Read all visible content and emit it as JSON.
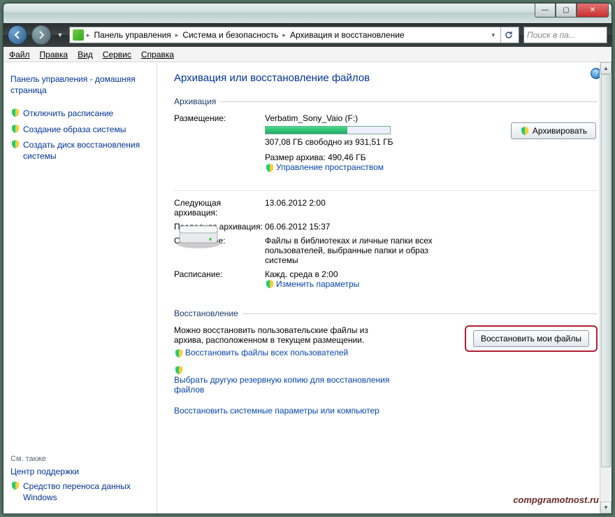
{
  "titlebar": {
    "min": "—",
    "max": "▢",
    "close": "✕"
  },
  "nav": {
    "breadcrumb": [
      "Панель управления",
      "Система и безопасность",
      "Архивация и восстановление"
    ],
    "search_placeholder": "Поиск в па..."
  },
  "menu": {
    "file": "Файл",
    "edit": "Правка",
    "view": "Вид",
    "tools": "Сервис",
    "help": "Справка"
  },
  "sidebar": {
    "home": "Панель управления - домашняя страница",
    "items": [
      "Отключить расписание",
      "Создание образа системы",
      "Создать диск восстановления системы"
    ],
    "see_also": "См. также",
    "support": "Центр поддержки",
    "transfer": "Средство переноса данных Windows"
  },
  "content": {
    "title": "Архивация или восстановление файлов",
    "archiving_label": "Архивация",
    "location_label": "Размещение:",
    "location_value": "Verbatim_Sony_Vaio (F:)",
    "free_space": "307,08 ГБ свободно из 931,51 ГБ",
    "archive_size": "Размер архива: 490,46 ГБ",
    "manage_space": "Управление пространством",
    "archive_btn": "Архивировать",
    "next_label": "Следующая архивация:",
    "next_value": "13.06.2012 2:00",
    "last_label": "Последняя архивация:",
    "last_value": "06.06.2012 15:37",
    "contents_label": "Содержание:",
    "contents_value": "Файлы в библиотеках и личные папки всех пользователей, выбранные папки и образ системы",
    "schedule_label": "Расписание:",
    "schedule_value": "Кажд. среда в 2:00",
    "change_params": "Изменить параметры",
    "restore_label": "Восстановление",
    "restore_text": "Можно восстановить пользовательские файлы из архива, расположенном в текущем размещении.",
    "restore_all_users": "Восстановить файлы всех пользователей",
    "choose_other": "Выбрать другую резервную копию для восстановления файлов",
    "restore_system": "Восстановить системные параметры или компьютер",
    "restore_btn": "Восстановить мои файлы"
  },
  "watermark": "compgramotnost.ru"
}
